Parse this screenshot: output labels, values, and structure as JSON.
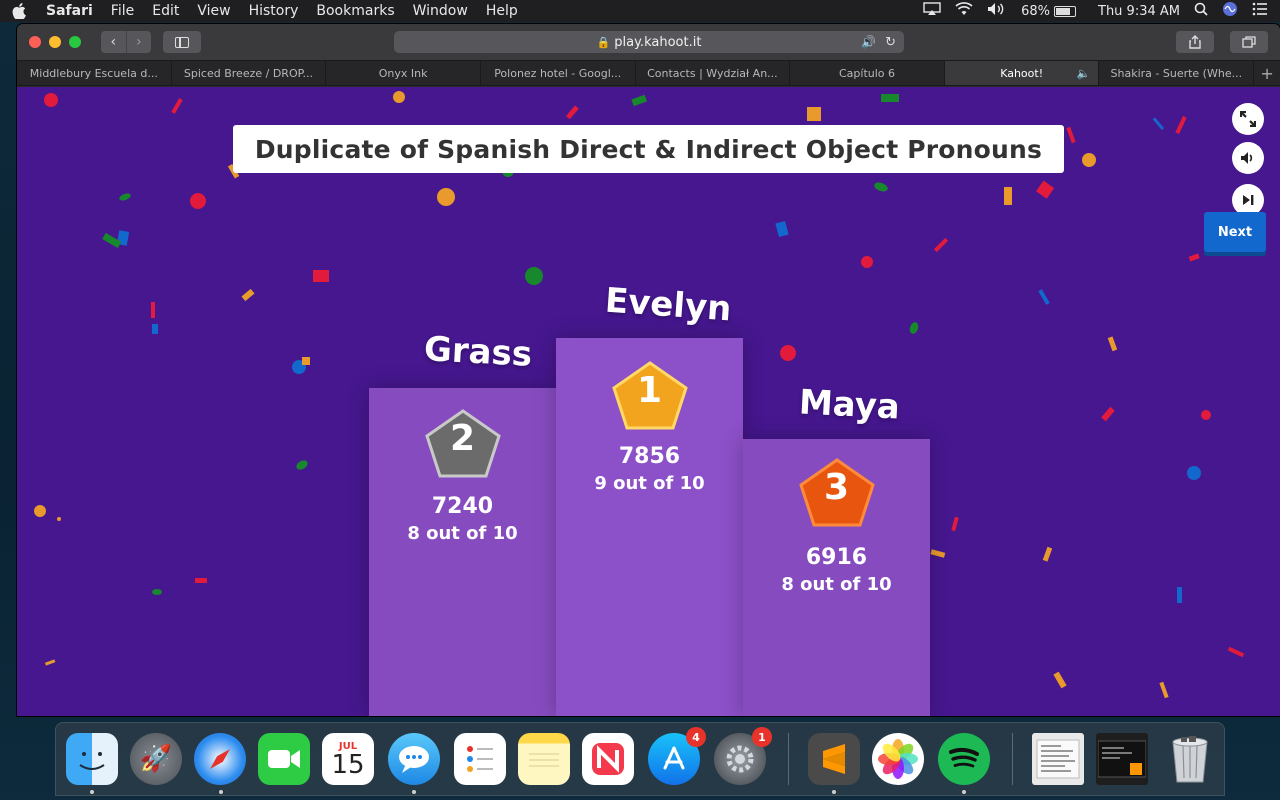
{
  "menubar": {
    "app": "Safari",
    "items": [
      "File",
      "Edit",
      "View",
      "History",
      "Bookmarks",
      "Window",
      "Help"
    ],
    "battery": "68%",
    "clock": "Thu 9:34 AM"
  },
  "browser": {
    "url": "play.kahoot.it",
    "tabs": [
      {
        "label": "Middlebury Escuela d..."
      },
      {
        "label": "Spiced Breeze / DROP..."
      },
      {
        "label": "Onyx Ink"
      },
      {
        "label": "Polonez hotel - Googl..."
      },
      {
        "label": "Contacts | Wydział An..."
      },
      {
        "label": "Capítulo 6"
      },
      {
        "label": "Kahoot!"
      },
      {
        "label": "Shakira - Suerte (Whe..."
      }
    ]
  },
  "kahoot": {
    "title": "Duplicate of Spanish Direct & Indirect Object Pronouns",
    "next_label": "Next",
    "podium": {
      "first": {
        "rank": "1",
        "name": "Evelyn",
        "score": "7856",
        "correct": "9 out of 10"
      },
      "second": {
        "rank": "2",
        "name": "Grass",
        "score": "7240",
        "correct": "8 out of 10"
      },
      "third": {
        "rank": "3",
        "name": "Maya",
        "score": "6916",
        "correct": "8 out of 10"
      }
    },
    "colors": {
      "background": "#46178f",
      "gold": "#f2a41e",
      "silver": "#6b6b6b",
      "bronze": "#e8550f",
      "next_button": "#1368ce"
    }
  },
  "dock": {
    "calendar_month": "JUL",
    "calendar_day": "15",
    "appstore_badge": "4",
    "settings_badge": "1",
    "apps": [
      "finder-icon",
      "launchpad-icon",
      "safari-icon",
      "facetime-icon",
      "calendar-icon",
      "messages-icon",
      "reminders-icon",
      "notes-icon",
      "news-icon",
      "app-store-icon",
      "system-preferences-icon",
      "sublime-text-icon",
      "photos-icon",
      "spotify-icon",
      "document-preview-icon",
      "terminal-icon",
      "trash-icon"
    ]
  }
}
